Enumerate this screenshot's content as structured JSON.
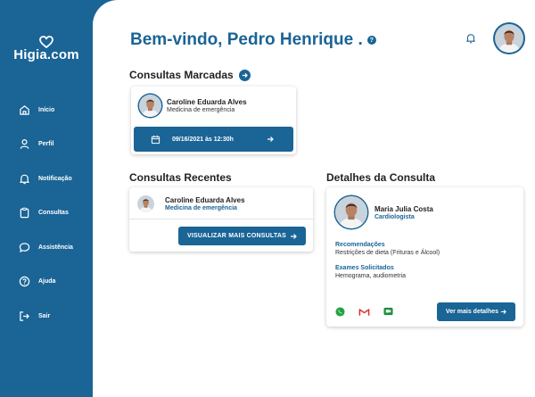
{
  "app": {
    "logo_text": "Higia.com"
  },
  "nav": {
    "items": [
      {
        "label": "Início",
        "icon": "home-icon"
      },
      {
        "label": "Perfil",
        "icon": "user-icon"
      },
      {
        "label": "Notificação",
        "icon": "bell-icon"
      },
      {
        "label": "Consultas",
        "icon": "clipboard-icon"
      },
      {
        "label": "Assistência",
        "icon": "chat-icon"
      },
      {
        "label": "Ajuda",
        "icon": "help-icon"
      },
      {
        "label": "Sair",
        "icon": "logout-icon"
      }
    ]
  },
  "header": {
    "title": "Bem-vindo, Pedro Henrique .",
    "help_glyph": "?"
  },
  "scheduled": {
    "title": "Consultas Marcadas",
    "doctor_name": "Caroline Eduarda Alves",
    "doctor_specialty": "Medicina de emergência",
    "datetime": "09/16/2021 às 12:30h"
  },
  "recent": {
    "title": "Consultas Recentes",
    "doctor_name": "Caroline Eduarda Alves",
    "doctor_specialty": "Medicina de emergência",
    "more_button": "VISUALIZAR MAIS CONSULTAS"
  },
  "details": {
    "title": "Detalhes da Consulta",
    "doctor_name": "Maria Julia Costa",
    "doctor_specialty": "Cardiologista",
    "recommendations_label": "Recomendações",
    "recommendations_text": "Restrições de dieta (Frituras e Álcool)",
    "exams_label": "Exames Solicitados",
    "exams_text": "Hemograma, audiometria",
    "more_button": "Ver mais detalhes",
    "contact_icons": [
      "whatsapp-icon",
      "gmail-icon",
      "meet-icon"
    ]
  },
  "colors": {
    "brand": "#1a6496",
    "background": "#ffffff",
    "text": "#222222"
  }
}
